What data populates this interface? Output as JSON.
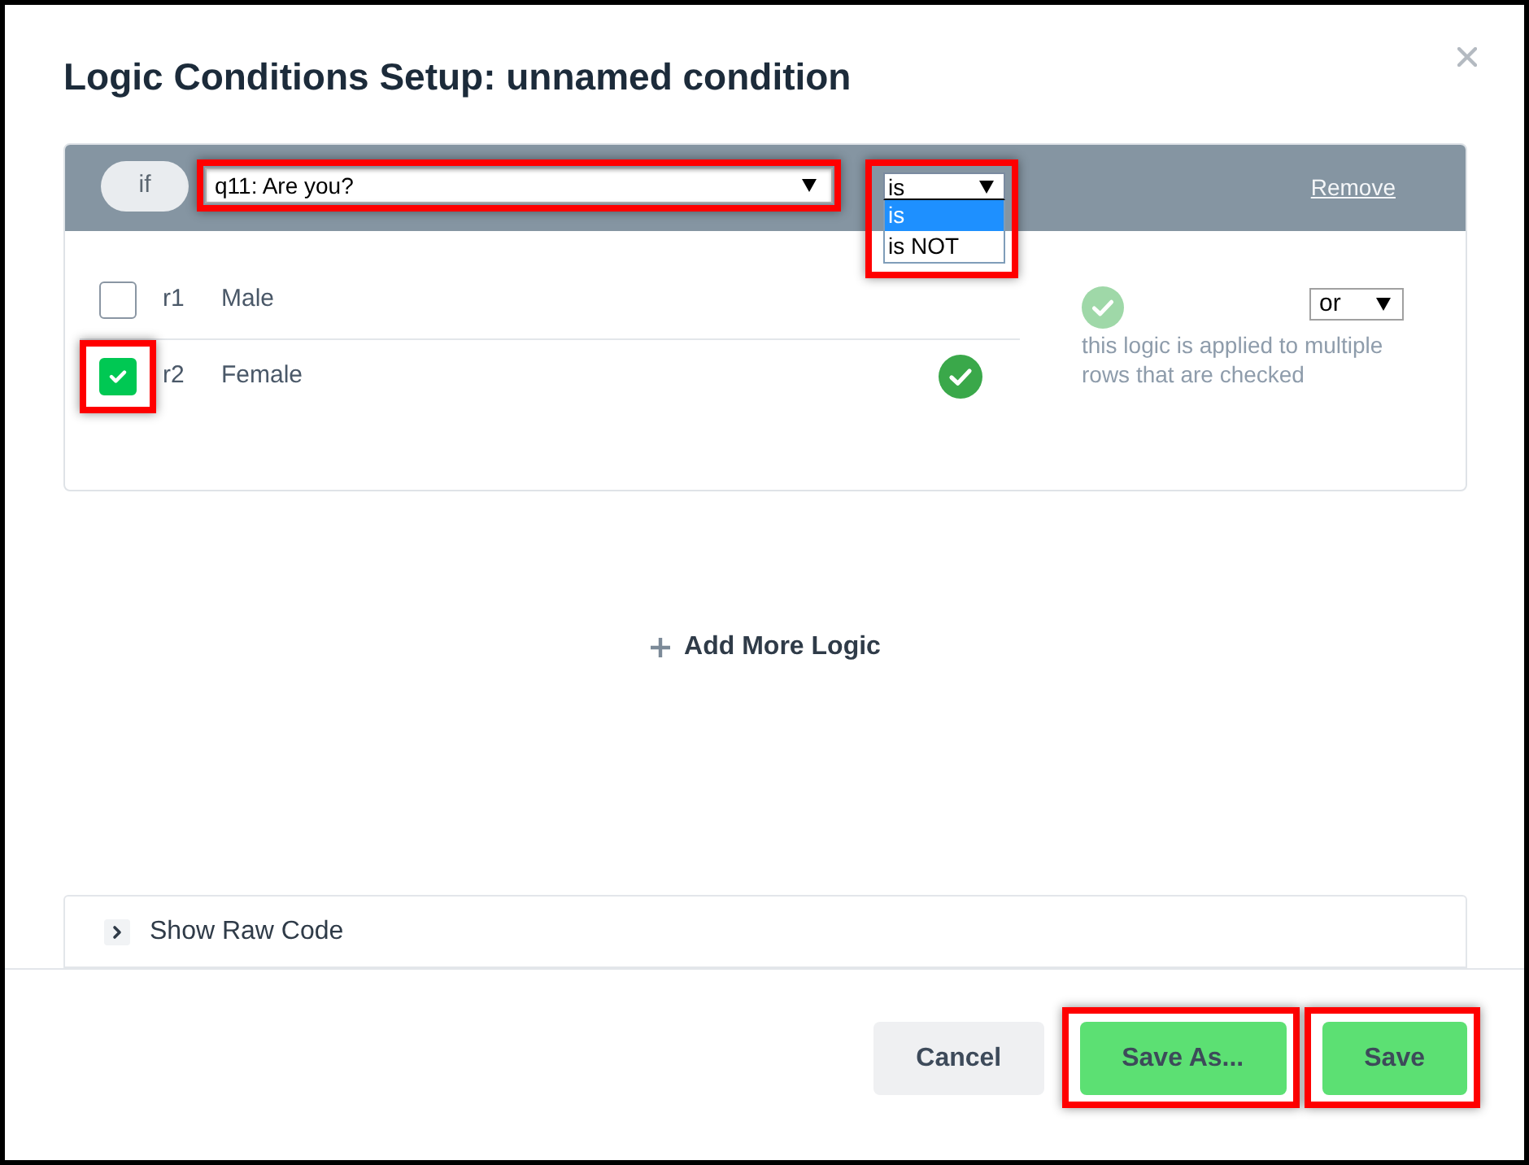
{
  "dialog": {
    "title": "Logic Conditions Setup: unnamed condition"
  },
  "condition": {
    "prefix": "if",
    "question": {
      "value": "q11: Are you?",
      "highlighted": true
    },
    "operator": {
      "value": "is",
      "expanded": true,
      "highlighted": true,
      "options": [
        {
          "label": "is",
          "selected": true
        },
        {
          "label": "is NOT",
          "selected": false
        }
      ]
    },
    "remove": "Remove",
    "rows": [
      {
        "code": "r1",
        "label": "Male",
        "checked": false,
        "highlighted": false
      },
      {
        "code": "r2",
        "label": "Female",
        "checked": true,
        "highlighted": true
      }
    ],
    "combine": {
      "value": "or",
      "note": "this logic is applied to multiple rows that are checked"
    }
  },
  "add_logic": "Add More Logic",
  "raw_code": {
    "label": "Show Raw Code",
    "expanded": false
  },
  "buttons": [
    {
      "label": "Cancel",
      "kind": "secondary",
      "highlighted": false
    },
    {
      "label": "Save As...",
      "kind": "primary",
      "highlighted": true
    },
    {
      "label": "Save",
      "kind": "primary",
      "highlighted": true
    }
  ]
}
